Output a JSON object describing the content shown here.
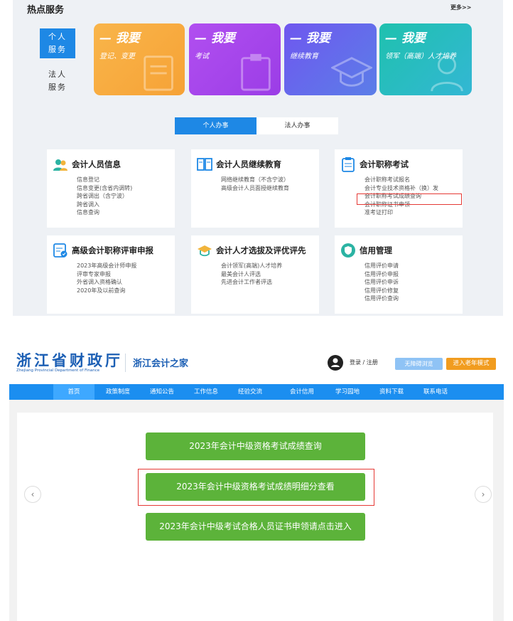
{
  "hot_services": {
    "title": "热点服务",
    "more": "更多>>",
    "side_tabs": [
      "个人\n服务",
      "法人\n服务"
    ],
    "cards": [
      {
        "big": "— 我要",
        "small": "登记、变更",
        "color": "#f7a83c"
      },
      {
        "big": "— 我要",
        "small": "考试",
        "color": "#a646ec"
      },
      {
        "big": "— 我要",
        "small": "继续教育",
        "color": "#6466ec"
      },
      {
        "big": "— 我要",
        "small": "领军（高端）人才培养",
        "color": "#27bcc0"
      }
    ],
    "switch": {
      "active": "个人办事",
      "inactive": "法人办事"
    },
    "categories": [
      {
        "title": "会计人员信息",
        "icon": "people-icon",
        "items": [
          "信息登记",
          "信息变更(含省内调转)",
          "跨省调出（含宁波）",
          "跨省调入",
          "信息查询"
        ]
      },
      {
        "title": "会计人员继续教育",
        "icon": "book-icon",
        "items": [
          "网络继续教育（不含宁波）",
          "高级会计人员面授继续教育"
        ]
      },
      {
        "title": "会计职称考试",
        "icon": "clipboard-icon",
        "items": [
          "会计职称考试报名",
          "会计专业技术资格补（换）发",
          "会计职称考试成绩查询",
          "会计职称证书申领",
          "准考证打印"
        ]
      },
      {
        "title": "高级会计职称评审申报",
        "icon": "document-check-icon",
        "items": [
          "2023年高级会计师申报",
          "评审专家申报",
          "外省调入资格确认",
          "2020年及以前查询"
        ]
      },
      {
        "title": "会计人才选拔及评优评先",
        "icon": "graduation-cap-icon",
        "items": [
          "会计领军(高端)人才培养",
          "最美会计人评选",
          "先进会计工作者评选"
        ]
      },
      {
        "title": "信用管理",
        "icon": "shield-icon",
        "items": [
          "信用评价申请",
          "信用评价申报",
          "信用评价申诉",
          "信用评价修复",
          "信用评价查询"
        ]
      }
    ]
  },
  "site": {
    "logo": "浙江省财政厅",
    "logo_en": "Zhejiang Provincial Department of Finance",
    "name": "浙江会计之家",
    "login": "登录 / 注册",
    "accessibility": "无障碍浏览",
    "elder_mode": "进入老年模式",
    "nav": [
      "首页",
      "政策制度",
      "通知公告",
      "工作信息",
      "经验交流",
      "会计信用",
      "学习园地",
      "资料下载",
      "联系电话"
    ],
    "buttons": [
      "2023年会计中级资格考试成绩查询",
      "2023年会计中级资格考试成绩明细分查看",
      "2023年会计中级考试合格人员证书申领请点击进入"
    ],
    "arrows": {
      "left": "‹",
      "right": "›"
    }
  },
  "colors": {
    "primary_blue": "#1e88e5",
    "nav_blue": "#1b8ef0",
    "green": "#5cb33a",
    "highlight_red": "#e53935",
    "orange": "#f19c1f"
  }
}
